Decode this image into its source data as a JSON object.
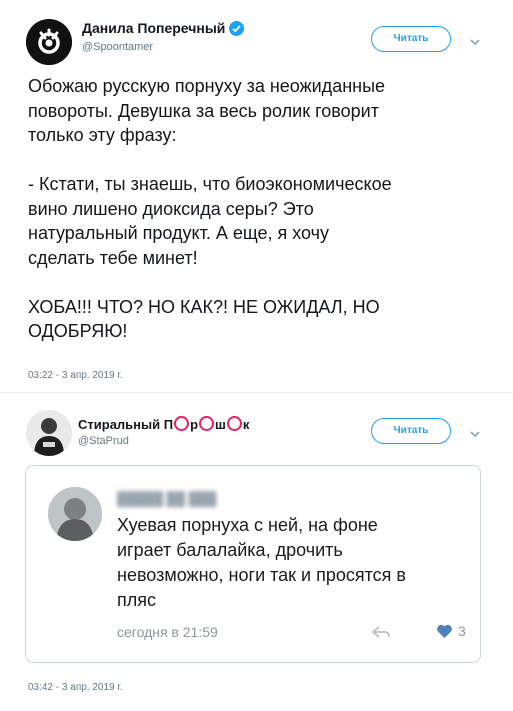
{
  "tweet1": {
    "author_name": "Данила Поперечный",
    "handle": "@Spoontamer",
    "follow_label": "Читать",
    "text_lines": [
      "Обожаю русскую порнуху за неожиданные",
      "повороты. Девушка за весь ролик говорит",
      "только эту фразу:",
      "",
      "- Кстати, ты знаешь, что биоэкономическое",
      "вино лишено диоксида серы? Это",
      "натуральный продукт. А еще, я хочу",
      "сделать тебе минет!",
      "",
      "ХОБА!!! ЧТО? НО КАК?! НЕ ОЖИДАЛ, НО",
      "ОДОБРЯЮ!"
    ],
    "timestamp": "03:22 - 3 апр. 2019 г."
  },
  "tweet2": {
    "author_name_parts": [
      "Стиральный П",
      "р",
      "ш",
      "к"
    ],
    "handle": "@StaPrud",
    "follow_label": "Читать",
    "quoted": {
      "text_lines": [
        "Хуевая порнуха с ней, на фоне",
        "играет балалайка, дрочить",
        "невозможно, ноги так и просятся в",
        "пляс"
      ],
      "time": "сегодня в 21:59",
      "likes": "3"
    },
    "timestamp": "03:42 - 3 апр. 2019 г."
  },
  "colors": {
    "accent": "#1da1f2",
    "text": "#14171a",
    "muted": "#657786",
    "circle": "#e0245e",
    "heart": "#5181b8"
  },
  "icons": [
    "verified-badge-icon",
    "chevron-down-icon",
    "reply-arrow-icon",
    "heart-icon"
  ]
}
